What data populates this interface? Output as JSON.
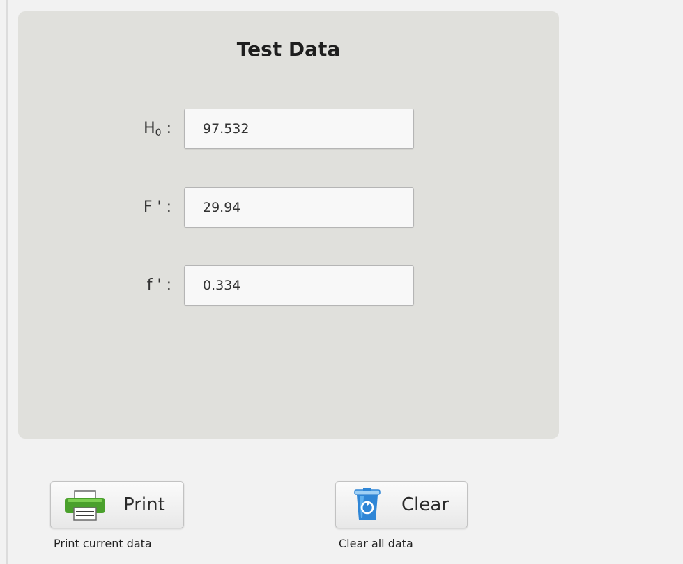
{
  "panel": {
    "title": "Test Data",
    "fields": [
      {
        "label_main": "H",
        "label_sub": "0",
        "label_suffix": " :",
        "value": "97.532"
      },
      {
        "label_main": "F ' :",
        "label_sub": "",
        "label_suffix": "",
        "value": "29.94"
      },
      {
        "label_main": "f ' :",
        "label_sub": "",
        "label_suffix": "",
        "value": "0.334"
      }
    ]
  },
  "actions": {
    "print": {
      "label": "Print",
      "caption": "Print current data",
      "icon": "printer-icon",
      "icon_color": "#4aa02c"
    },
    "clear": {
      "label": "Clear",
      "caption": "Clear all data",
      "icon": "recycle-bin-icon",
      "icon_color": "#2f86d6"
    }
  }
}
